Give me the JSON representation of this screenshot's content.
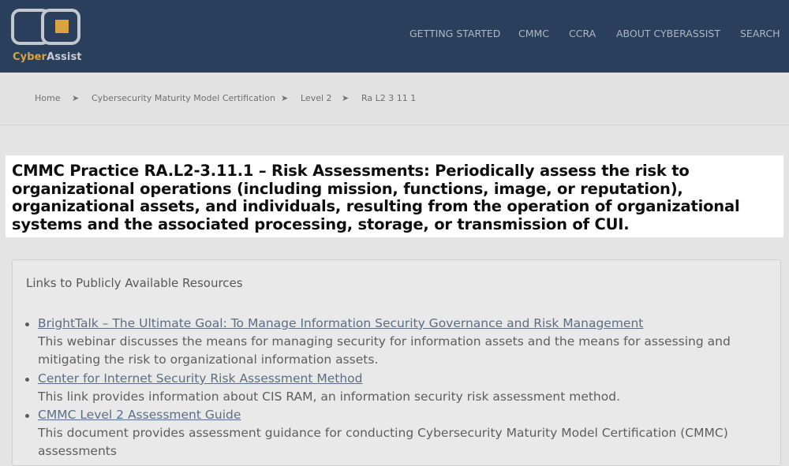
{
  "brand": {
    "name_part1": "Cyber",
    "name_part2": "Assist",
    "accent": "#d7a43f"
  },
  "nav": {
    "items": [
      "GETTING STARTED",
      "CMMC",
      "CCRA",
      "ABOUT CYBERASSIST",
      "SEARCH"
    ]
  },
  "breadcrumb": {
    "items": [
      "Home",
      "Cybersecurity Maturity Model Certification",
      "Level 2",
      "Ra L2 3 11 1"
    ],
    "separator": "➤"
  },
  "heading": {
    "text": "CMMC Practice RA.L2-3.11.1 – Risk Assessments: Periodically assess the risk to organizational operations (including mission, functions, image, or reputation), organizational assets, and individuals, resulting from the operation of organizational systems and the associated processing, storage, or transmission of CUI."
  },
  "resources": {
    "title": "Links to Publicly Available Resources",
    "items": [
      {
        "link": "BrightTalk – The Ultimate Goal: To Manage Information Security Governance and Risk Management",
        "description": "This webinar discusses the means for managing security for information assets and the means for assessing and mitigating the risk to organizational information assets."
      },
      {
        "link": "Center for Internet Security Risk Assessment Method",
        "description": "This link provides information about CIS RAM, an information security risk assessment method."
      },
      {
        "link": "CMMC Level 2 Assessment Guide",
        "description": "This document provides assessment guidance for conducting Cybersecurity Maturity Model Certification (CMMC) assessments"
      }
    ]
  },
  "colors": {
    "header_bg": "#2a3f5c",
    "page_bg": "#e4e4e4",
    "link": "#5b6e85",
    "highlight_bg": "#ffffff"
  }
}
